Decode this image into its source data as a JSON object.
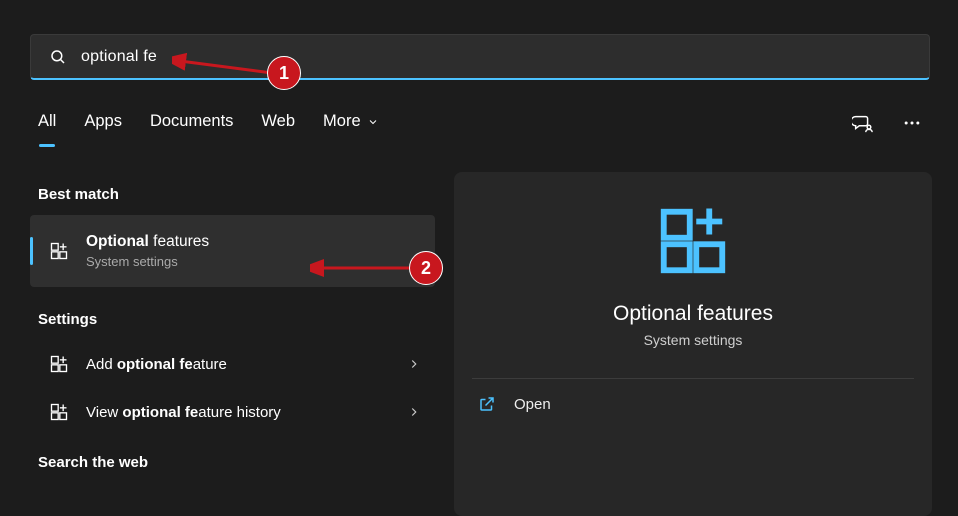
{
  "search": {
    "value": "optional fe"
  },
  "tabs": {
    "all": "All",
    "apps": "Apps",
    "documents": "Documents",
    "web": "Web",
    "more": "More"
  },
  "sections": {
    "bestMatch": "Best match",
    "settings": "Settings",
    "searchWeb": "Search the web"
  },
  "bestMatch": {
    "title_bold": "Optional ",
    "title_rest": "features",
    "subtitle": "System settings"
  },
  "settingsItems": {
    "add": {
      "prefix": "Add ",
      "bold": "optional fe",
      "suffix": "ature"
    },
    "history": {
      "prefix": "View ",
      "bold": "optional fe",
      "suffix": "ature history"
    }
  },
  "detail": {
    "title": "Optional features",
    "subtitle": "System settings",
    "open": "Open"
  },
  "annotations": {
    "one": "1",
    "two": "2"
  }
}
